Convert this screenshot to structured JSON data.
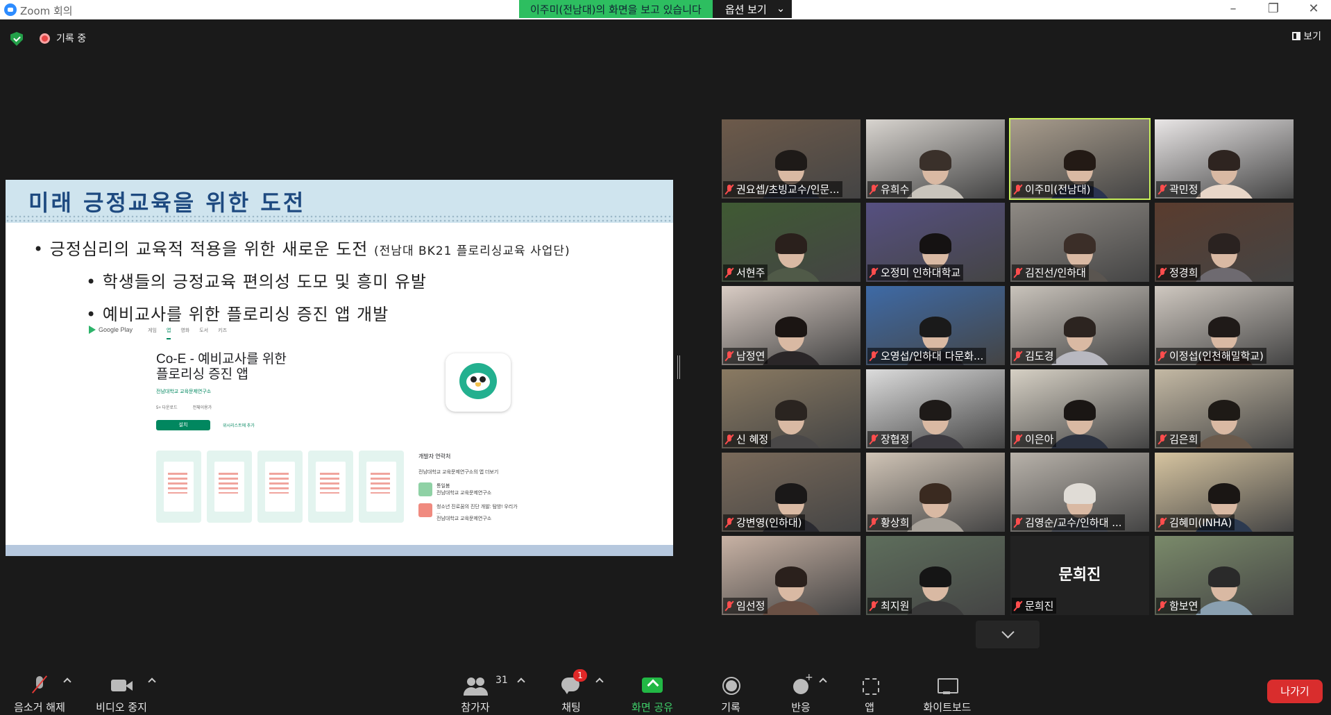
{
  "window": {
    "title": "Zoom 회의",
    "controls": [
      "minimize-icon",
      "restore-icon",
      "close-icon"
    ]
  },
  "sharing_banner": {
    "message": "이주미(전남대)의 화면을 보고 있습니다",
    "options_label": "옵션 보기",
    "chevron": "⌄"
  },
  "topbar": {
    "recording_label": "기록 중",
    "view_label": "보기"
  },
  "slide": {
    "title": "미래 긍정교육을 위한 도전",
    "bullet_main": "긍정심리의 교육적 적용을 위한 새로운 도전",
    "bullet_main_note": "(전남대 BK21 플로리싱교육 사업단)",
    "sub_bullets": [
      "학생들의 긍정교육 편의성 도모 및 흥미 유발",
      "예비교사를 위한 플로리싱 증진 앱 개발"
    ],
    "play_store": {
      "brand": "Google Play",
      "tabs": [
        "게임",
        "앱",
        "영화",
        "도서",
        "키즈"
      ],
      "app_title_line1": "Co-E - 예비교사를 위한",
      "app_title_line2": "플로리싱 증진 앱",
      "publisher": "전남대학교 교육문제연구소",
      "meta": [
        "5+ 다운로드",
        "전체이용가"
      ],
      "install_label": "설치",
      "wishlist_label": "위시리스트에 추가",
      "developer_contact": "개발자 연락처",
      "more_from": "전남대학교 교육문제연구소의 앱 더보기",
      "more_apps": [
        {
          "name": "통일봄",
          "publisher": "전남대학교 교육문제연구소"
        },
        {
          "name": "청소년 진로꿈의 진단 개발: 탐방! 우리가 ...",
          "publisher": "전남대학교 교육문제연구소"
        }
      ]
    }
  },
  "participants": [
    {
      "name": "권요셉/초빙교수/인문...",
      "bg": "#6d5a4a",
      "hair": "#1e1a18",
      "shirt": "#2f3440"
    },
    {
      "name": "유희수",
      "bg": "#d8d4cf",
      "hair": "#3a302a",
      "shirt": "#c9c4bc"
    },
    {
      "name": "이주미(전남대)",
      "bg": "#a89c8c",
      "hair": "#231a15",
      "shirt": "#2a3350",
      "active": true
    },
    {
      "name": "곽민정",
      "bg": "#e9e6e6",
      "hair": "#2e2420",
      "shirt": "#e8d6c8"
    },
    {
      "name": "서현주",
      "bg": "#3f5a33",
      "hair": "#2a201c",
      "shirt": "#505a48"
    },
    {
      "name": "오정미 인하대학교",
      "bg": "#565081",
      "hair": "#151212",
      "shirt": "#3e3a44"
    },
    {
      "name": "김진선/인하대",
      "bg": "#8f8a84",
      "hair": "#3b2e28",
      "shirt": "#5a5550"
    },
    {
      "name": "정경희",
      "bg": "#5a3c2e",
      "hair": "#2a2220",
      "shirt": "#6e6a70"
    },
    {
      "name": "남정연",
      "bg": "#d9ccc4",
      "hair": "#1b1513",
      "shirt": "#2a2628"
    },
    {
      "name": "오영섭/인하대 다문화...",
      "bg": "#3e6aa6",
      "hair": "#1a1a1a",
      "shirt": "#2c2c34"
    },
    {
      "name": "김도경",
      "bg": "#c9c3bb",
      "hair": "#2c2420",
      "shirt": "#b8b8c0"
    },
    {
      "name": "이정섭(인천해밀학교)",
      "bg": "#cfc8c0",
      "hair": "#1f1a18",
      "shirt": "#3a2e2a"
    },
    {
      "name": "신 혜정",
      "bg": "#8a7a62",
      "hair": "#2a2420",
      "shirt": "#4a4848"
    },
    {
      "name": "장협정",
      "bg": "#dcdcdc",
      "hair": "#1e1a18",
      "shirt": "#3c3a40"
    },
    {
      "name": "이은아",
      "bg": "#d6d0c4",
      "hair": "#1a1614",
      "shirt": "#2c3240"
    },
    {
      "name": "김은희",
      "bg": "#c4b9a4",
      "hair": "#1e1a16",
      "shirt": "#6a5a4c"
    },
    {
      "name": "강변영(인하대)",
      "bg": "#7a6a5a",
      "hair": "#1a1818",
      "shirt": "#2a2a30"
    },
    {
      "name": "황상희",
      "bg": "#d0c4b6",
      "hair": "#3a2a20",
      "shirt": "#a8a29a"
    },
    {
      "name": "김영순/교수/인하대 ...",
      "bg": "#b8b2aa",
      "hair": "#e0dcd6",
      "shirt": "#4a4e58"
    },
    {
      "name": "김혜미(INHA)",
      "bg": "#d6c4a0",
      "hair": "#1a1614",
      "shirt": "#2c3a50"
    },
    {
      "name": "임선정",
      "bg": "#c8b2a4",
      "hair": "#2a201c",
      "shirt": "#6a5044"
    },
    {
      "name": "최지원",
      "bg": "#5e6e5c",
      "hair": "#151515",
      "shirt": "#3a3a3a"
    },
    {
      "name": "문희진",
      "no_video": true
    },
    {
      "name": "함보연",
      "bg": "#7a8a6a",
      "hair": "#2a2a2a",
      "shirt": "#8aa0b0"
    }
  ],
  "controls": {
    "mute_label": "음소거 해제",
    "video_label": "비디오 중지",
    "participants_label": "참가자",
    "participants_count": "31",
    "chat_label": "채팅",
    "chat_badge": "1",
    "share_label": "화면 공유",
    "record_label": "기록",
    "reactions_label": "반응",
    "apps_label": "앱",
    "whiteboard_label": "화이트보드",
    "leave_label": "나가기"
  },
  "colors": {
    "share_green": "#22b845",
    "active_speaker": "#c8f05a",
    "leave_red": "#d92d2d",
    "slide_title": "#1e4a80"
  }
}
